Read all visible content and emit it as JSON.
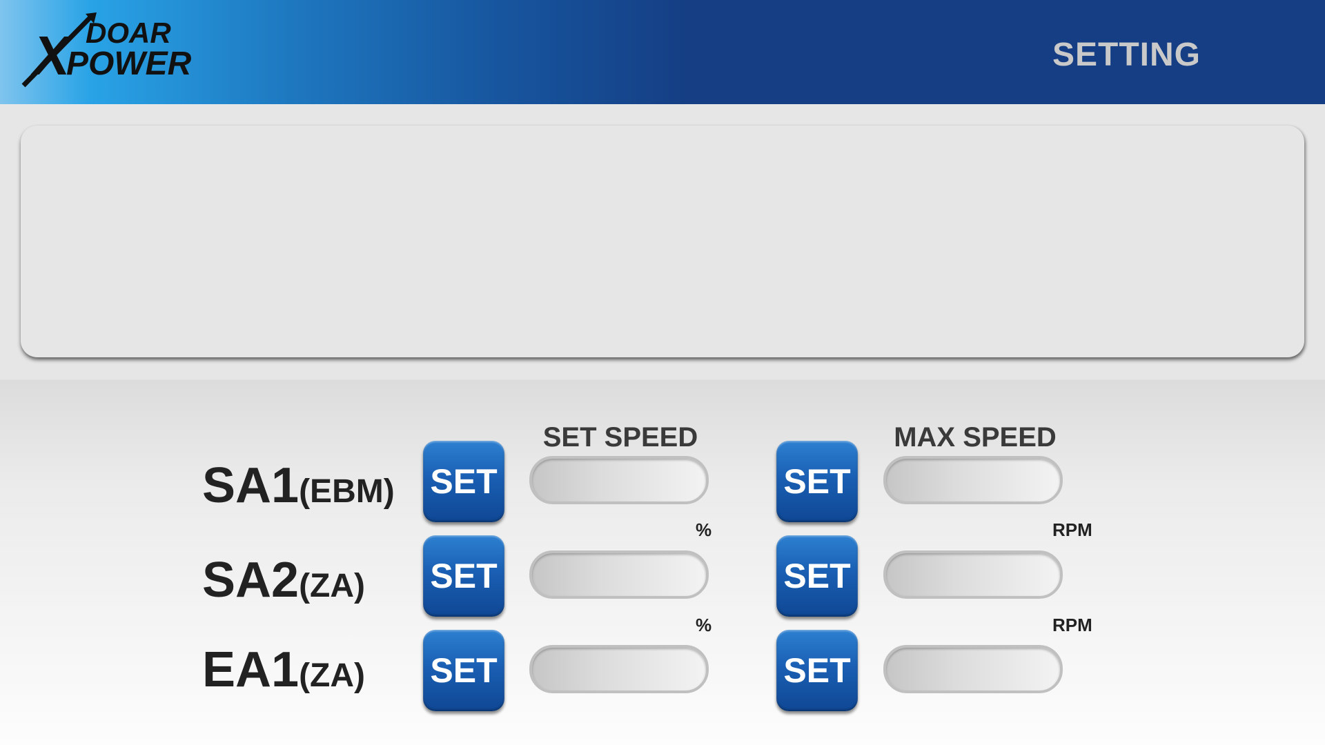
{
  "header": {
    "logo_text_top": "DOAR",
    "logo_text_bottom": "POWER",
    "page_title": "SETTING"
  },
  "columns": {
    "set_speed": "SET SPEED",
    "max_speed": "MAX SPEED"
  },
  "rows": [
    {
      "label": "SA1",
      "sub": "(EBM)",
      "speed_button": "SET",
      "speed_value": "",
      "max_button": "SET",
      "max_value": ""
    },
    {
      "label": "SA2",
      "sub": "(ZA)",
      "speed_button": "SET",
      "speed_value": "",
      "max_button": "SET",
      "max_value": ""
    },
    {
      "label": "EA1",
      "sub": "(ZA)",
      "speed_button": "SET",
      "speed_value": "",
      "max_button": "SET",
      "max_value": ""
    }
  ],
  "units": {
    "speed": "%",
    "max": "RPM"
  },
  "colors": {
    "header_dark": "#153e84",
    "header_light": "#29a3e6",
    "button_blue": "#1a5fb3",
    "title_gray": "#c9c9c9"
  }
}
